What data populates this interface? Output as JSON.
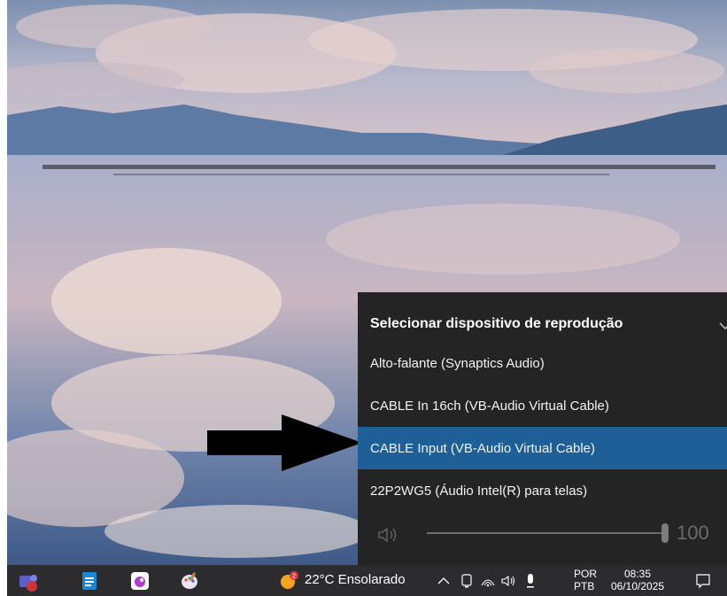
{
  "flyout": {
    "title": "Selecionar dispositivo de reprodução",
    "devices": [
      {
        "label": "Alto-falante (Synaptics Audio)",
        "selected": false
      },
      {
        "label": "CABLE In 16ch (VB-Audio Virtual Cable)",
        "selected": false
      },
      {
        "label": "CABLE Input (VB-Audio Virtual Cable)",
        "selected": true
      },
      {
        "label": "22P2WG5 (Áudio Intel(R) para telas)",
        "selected": false
      }
    ],
    "volume": "100"
  },
  "taskbar": {
    "apps": [
      "teams-icon",
      "docs-icon",
      "app-icon",
      "paint-icon"
    ],
    "weather": {
      "badge": "2",
      "text": "22°C  Ensolarado"
    },
    "language": {
      "line1": "POR",
      "line2": "PTB"
    },
    "clock": {
      "time": "08:35",
      "date": "06/10/2025"
    }
  },
  "colors": {
    "flyout_bg": "#242424",
    "selected": "#1f5f98",
    "taskbar_bg": "#2c2c2e"
  }
}
